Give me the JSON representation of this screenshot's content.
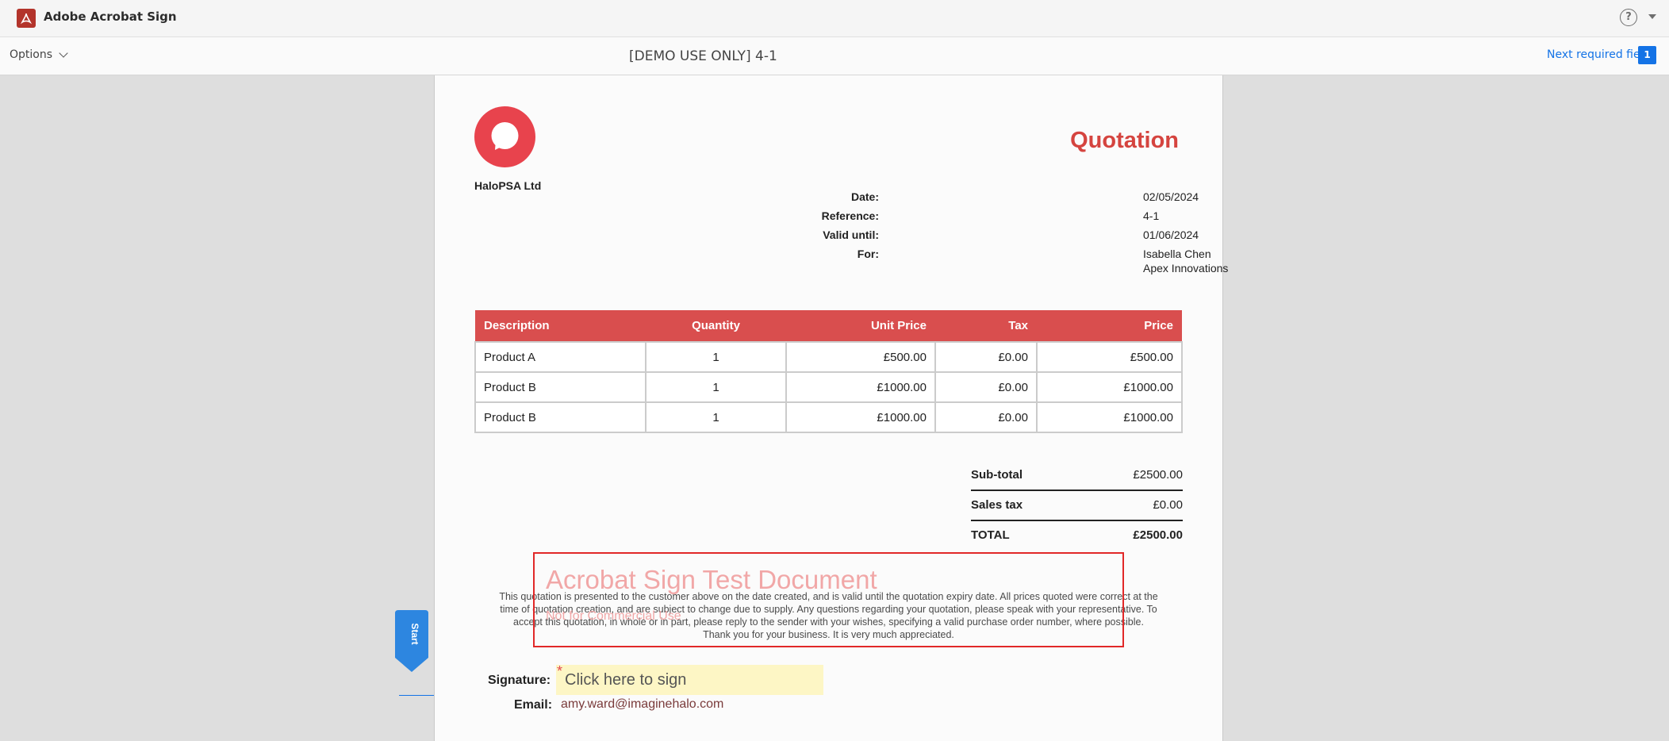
{
  "app": {
    "title": "Adobe Acrobat Sign",
    "help_symbol": "?"
  },
  "toolbar": {
    "options_label": "Options",
    "document_name": "[DEMO USE ONLY] 4-1",
    "next_required_label": "Next required field",
    "next_required_count": "1"
  },
  "document": {
    "company_name": "HaloPSA Ltd",
    "title": "Quotation",
    "meta": [
      {
        "key": "Date:",
        "value": "02/05/2024"
      },
      {
        "key": "Reference:",
        "value": "4-1"
      },
      {
        "key": "Valid until:",
        "value": "01/06/2024"
      },
      {
        "key": "For:",
        "value": "Isabella Chen",
        "value2": "Apex Innovations"
      }
    ],
    "table": {
      "headers": [
        "Description",
        "Quantity",
        "Unit Price",
        "Tax",
        "Price"
      ],
      "rows": [
        [
          "Product A",
          "1",
          "£500.00",
          "£0.00",
          "£500.00"
        ],
        [
          "Product B",
          "1",
          "£1000.00",
          "£0.00",
          "£1000.00"
        ],
        [
          "Product B",
          "1",
          "£1000.00",
          "£0.00",
          "£1000.00"
        ]
      ]
    },
    "totals": [
      {
        "label": "Sub-total",
        "value": "£2500.00"
      },
      {
        "label": "Sales tax",
        "value": "£0.00"
      },
      {
        "label": "TOTAL",
        "value": "£2500.00"
      }
    ],
    "terms": [
      "This quotation is presented to the customer above on the date created, and is valid until the quotation expiry date. All prices quoted were correct at the",
      "time of quotation creation, and are subject to change due to supply. Any questions regarding your quotation, please speak with your representative. To",
      "accept this quotation, in whole or in part, please reply to the sender with your wishes, specifying a valid purchase order number, where possible.",
      "Thank you for your business. It is very much appreciated."
    ],
    "watermark": {
      "title": "Acrobat Sign Test Document",
      "subtitle": "Not for Commercial Use"
    },
    "signature_label": "Signature:",
    "signature_placeholder": "Click here to sign",
    "email_label": "Email:",
    "email_value": "amy.ward@imaginehalo.com"
  },
  "start_tab_label": "Start",
  "colors": {
    "accent": "#1473e6",
    "brand_red": "#d94e4e",
    "watermark_red": "#e12828"
  }
}
